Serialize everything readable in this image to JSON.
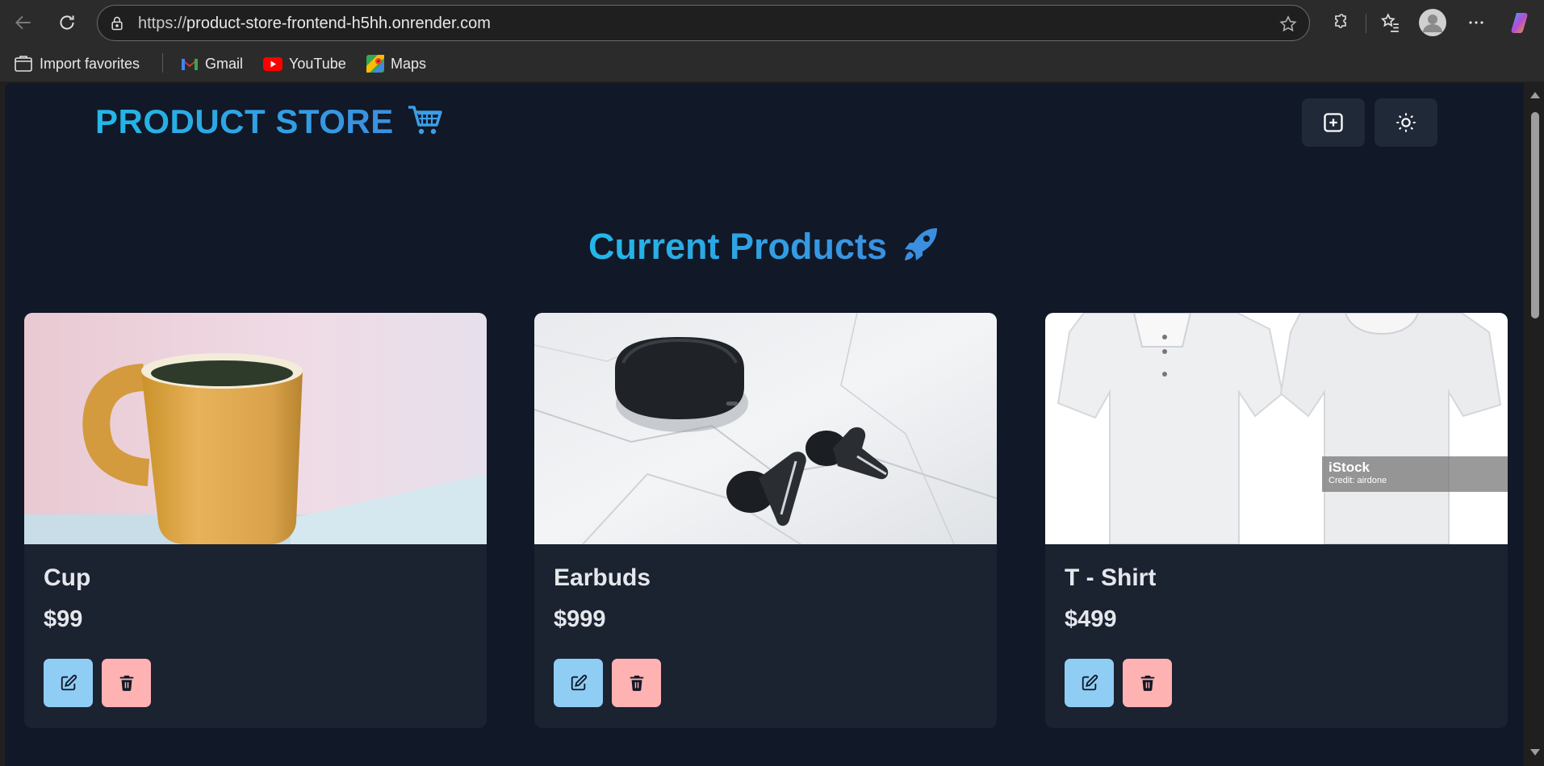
{
  "browser": {
    "url_protocol": "https://",
    "url_host": "product-store-frontend-h5hh.onrender.com",
    "bookmarks": [
      {
        "label": "Import favorites"
      },
      {
        "label": "Gmail"
      },
      {
        "label": "YouTube"
      },
      {
        "label": "Maps"
      }
    ]
  },
  "header": {
    "brand": "PRODUCT STORE",
    "brand_emoji": "🛒",
    "create_icon": "plus-square-icon",
    "theme_icon": "sun-icon"
  },
  "main": {
    "heading": "Current Products",
    "heading_emoji": "🚀"
  },
  "products": [
    {
      "name": "Cup",
      "price": "$99",
      "image": "mug-photo"
    },
    {
      "name": "Earbuds",
      "price": "$999",
      "image": "earbuds-photo"
    },
    {
      "name": "T - Shirt",
      "price": "$499",
      "image": "tshirt-photo",
      "watermark_title": "iStock",
      "watermark_credit": "Credit: airdone"
    }
  ],
  "colors": {
    "page_bg": "#111827",
    "card_bg": "#1b2230",
    "accent_gradient_start": "#22b8e8",
    "accent_gradient_end": "#3b8fe0",
    "edit_button": "#90cdf4",
    "delete_button": "#feb2b2"
  }
}
